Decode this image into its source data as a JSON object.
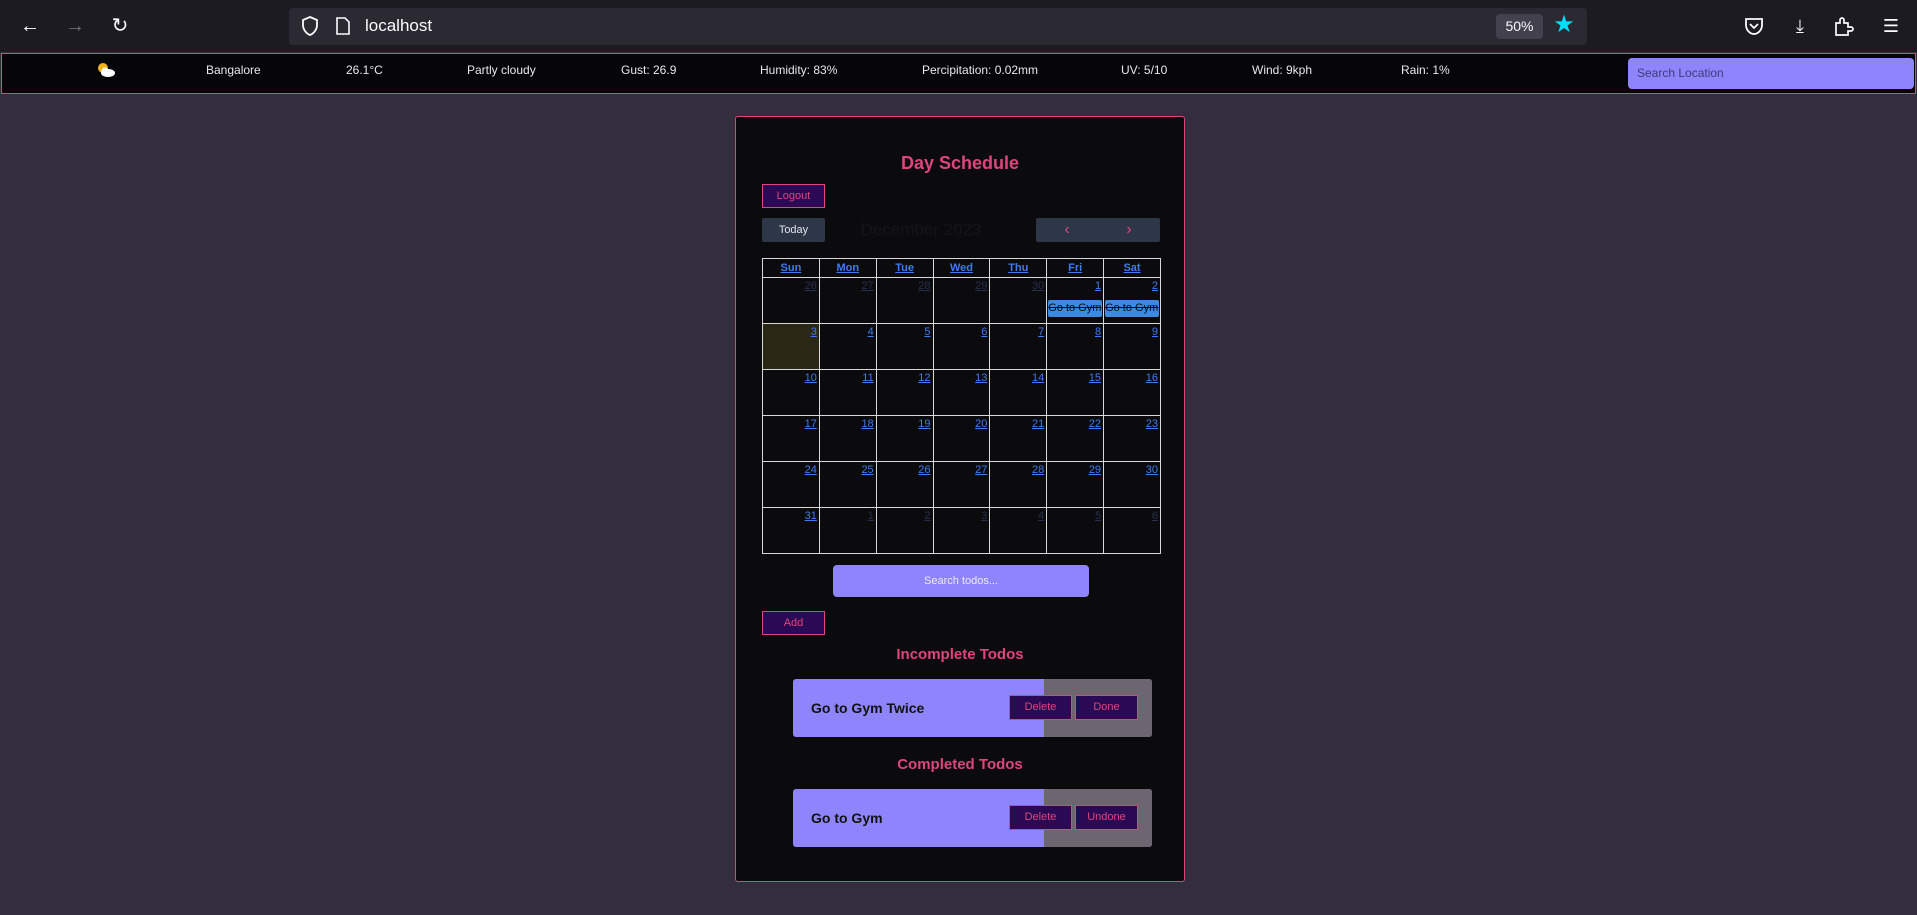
{
  "browser": {
    "url": "localhost",
    "zoom": "50%"
  },
  "weather": {
    "city": "Bangalore",
    "temperature": "26.1°C",
    "condition": "Partly cloudy",
    "gust": "Gust: 26.9",
    "humidity": "Humidity: 83%",
    "precipitation": "Percipitation: 0.02mm",
    "uv": "UV: 5/10",
    "wind": "Wind: 9kph",
    "rain": "Rain: 1%",
    "search_placeholder": "Search Location"
  },
  "schedule": {
    "title": "Day Schedule",
    "logout_label": "Logout",
    "today_label": "Today",
    "month_label": "December 2023",
    "prev_icon": "‹",
    "next_icon": "›"
  },
  "calendar": {
    "weekdays": [
      "Sun",
      "Mon",
      "Tue",
      "Wed",
      "Thu",
      "Fri",
      "Sat"
    ],
    "weeks": [
      [
        "26",
        "27",
        "28",
        "29",
        "30",
        "1",
        "2"
      ],
      [
        "3",
        "4",
        "5",
        "6",
        "7",
        "8",
        "9"
      ],
      [
        "10",
        "11",
        "12",
        "13",
        "14",
        "15",
        "16"
      ],
      [
        "17",
        "18",
        "19",
        "20",
        "21",
        "22",
        "23"
      ],
      [
        "24",
        "25",
        "26",
        "27",
        "28",
        "29",
        "30"
      ],
      [
        "31",
        "1",
        "2",
        "3",
        "4",
        "5",
        "6"
      ]
    ],
    "events": [
      "Go to Gym",
      "Go to Gym"
    ]
  },
  "todos": {
    "search_placeholder": "Search todos...",
    "add_label": "Add",
    "incomplete_title": "Incomplete Todos",
    "completed_title": "Completed Todos",
    "incomplete": [
      {
        "text": "Go to Gym Twice",
        "delete_label": "Delete",
        "action_label": "Done"
      }
    ],
    "completed": [
      {
        "text": "Go to Gym",
        "delete_label": "Delete",
        "action_label": "Undone"
      }
    ]
  },
  "colors": {
    "accent": "#e0457a",
    "link": "#3d7cf0",
    "input": "#8e84fb",
    "background": "#342d3d"
  }
}
